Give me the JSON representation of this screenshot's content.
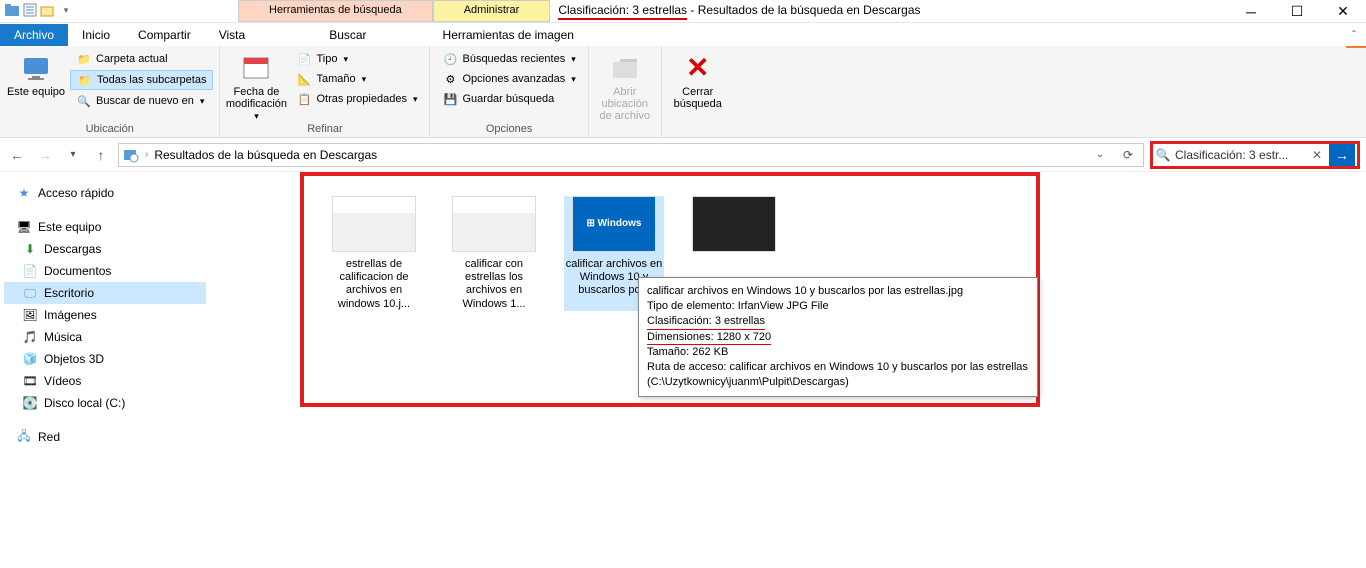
{
  "titlebar": {
    "search_tools": "Herramientas de búsqueda",
    "manage": "Administrar",
    "title_query": "Clasificación: 3 estrellas",
    "title_suffix": " - Resultados de la búsqueda en Descargas"
  },
  "ribbon_tabs": {
    "file": "Archivo",
    "home": "Inicio",
    "share": "Compartir",
    "view": "Vista",
    "search": "Buscar",
    "image_tools": "Herramientas de imagen"
  },
  "ribbon": {
    "this_pc": "Este equipo",
    "current_folder": "Carpeta actual",
    "all_subfolders": "Todas las subcarpetas",
    "search_again_in": "Buscar de nuevo en",
    "group_location": "Ubicación",
    "date_mod": "Fecha de modificación",
    "type": "Tipo",
    "size": "Tamaño",
    "other_props": "Otras propiedades",
    "group_refine": "Refinar",
    "recent_searches": "Búsquedas recientes",
    "advanced_options": "Opciones avanzadas",
    "save_search": "Guardar búsqueda",
    "group_options": "Opciones",
    "open_location": "Abrir ubicación de archivo",
    "close_search": "Cerrar búsqueda"
  },
  "address": {
    "path": "Resultados de la búsqueda en Descargas"
  },
  "search": {
    "text": "Clasificación: 3 estr..."
  },
  "nav": {
    "quick_access": "Acceso rápido",
    "this_pc": "Este equipo",
    "downloads": "Descargas",
    "documents": "Documentos",
    "desktop": "Escritorio",
    "images": "Imágenes",
    "music": "Música",
    "objects3d": "Objetos 3D",
    "videos": "Vídeos",
    "local_disk": "Disco local (C:)",
    "network": "Red"
  },
  "files": [
    {
      "name": "estrellas de calificacion de archivos en windows 10.j..."
    },
    {
      "name": "calificar con estrellas los archivos en Windows 1..."
    },
    {
      "name": "calificar archivos en Windows 10 y buscarlos po..."
    },
    {
      "name": ""
    }
  ],
  "tooltip": {
    "l1": "calificar archivos en Windows 10 y buscarlos por las estrellas.jpg",
    "l2": "Tipo de elemento: IrfanView JPG File",
    "l3": "Clasificación: 3 estrellas",
    "l4": "Dimensiones: 1280 x 720",
    "l5": "Tamaño: 262 KB",
    "l6": "Ruta de acceso: calificar archivos en Windows 10 y buscarlos por las estrellas (C:\\Uzytkownicy\\juanm\\Pulpit\\Descargas)"
  }
}
